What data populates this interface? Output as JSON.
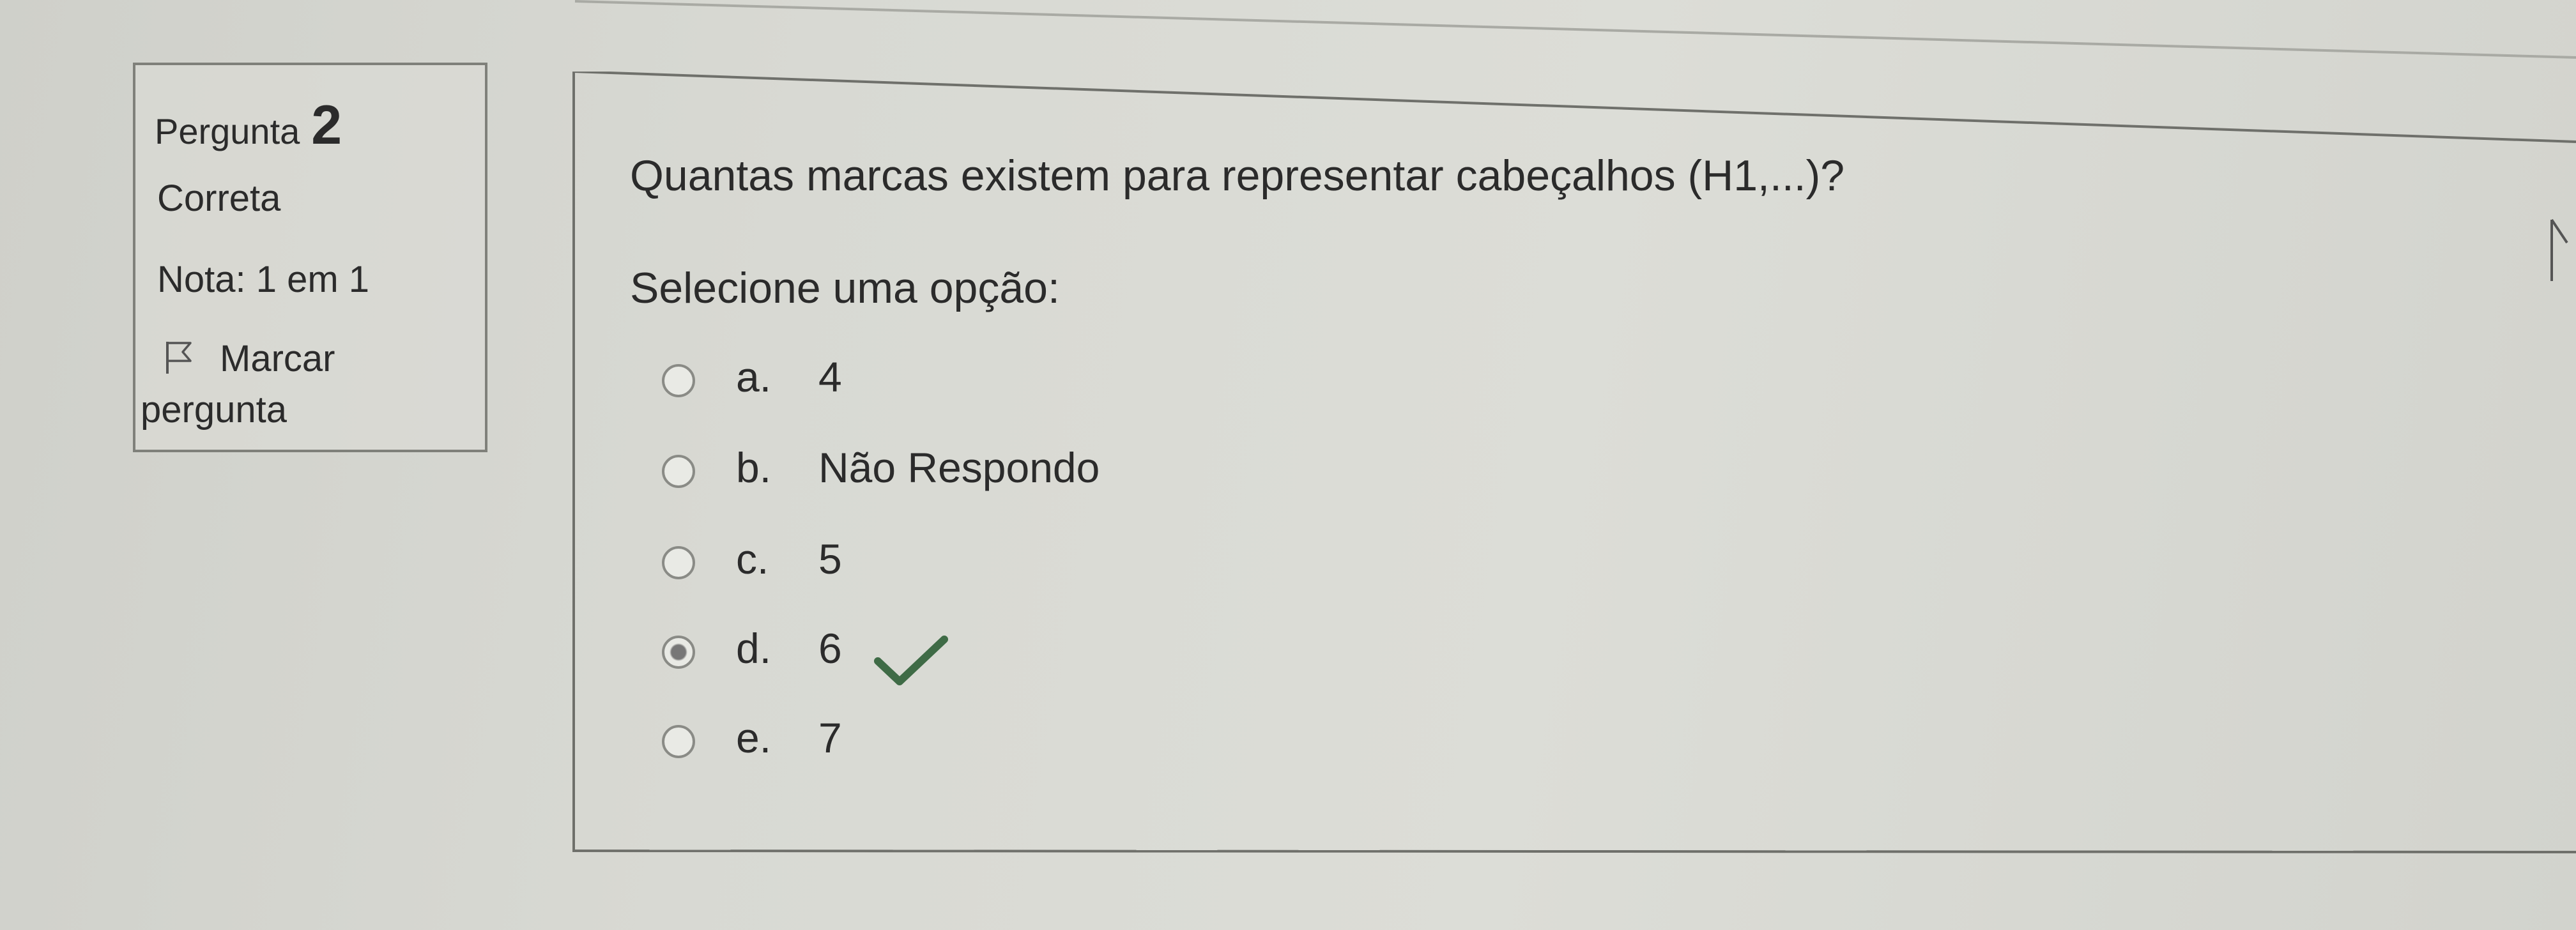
{
  "question_info": {
    "label": "Pergunta",
    "number": "2",
    "state": "Correta",
    "grade": "Nota: 1 em 1",
    "flag_label_1": "Marcar",
    "flag_label_2": "pergunta",
    "flag_icon": "flag-icon"
  },
  "question": {
    "text": "Quantas marcas existem para representar cabeçalhos (H1,...)?",
    "prompt": "Selecione uma opção:"
  },
  "answers": [
    {
      "letter": "a.",
      "text": "4",
      "selected": false
    },
    {
      "letter": "b.",
      "text": "Não Respondo",
      "selected": false
    },
    {
      "letter": "c.",
      "text": "5",
      "selected": false
    },
    {
      "letter": "d.",
      "text": "6",
      "selected": true,
      "correct": true,
      "icon": "checkmark-icon"
    },
    {
      "letter": "e.",
      "text": "7",
      "selected": false
    }
  ],
  "colors": {
    "check": "#3f6b46",
    "border": "#7f807a"
  }
}
